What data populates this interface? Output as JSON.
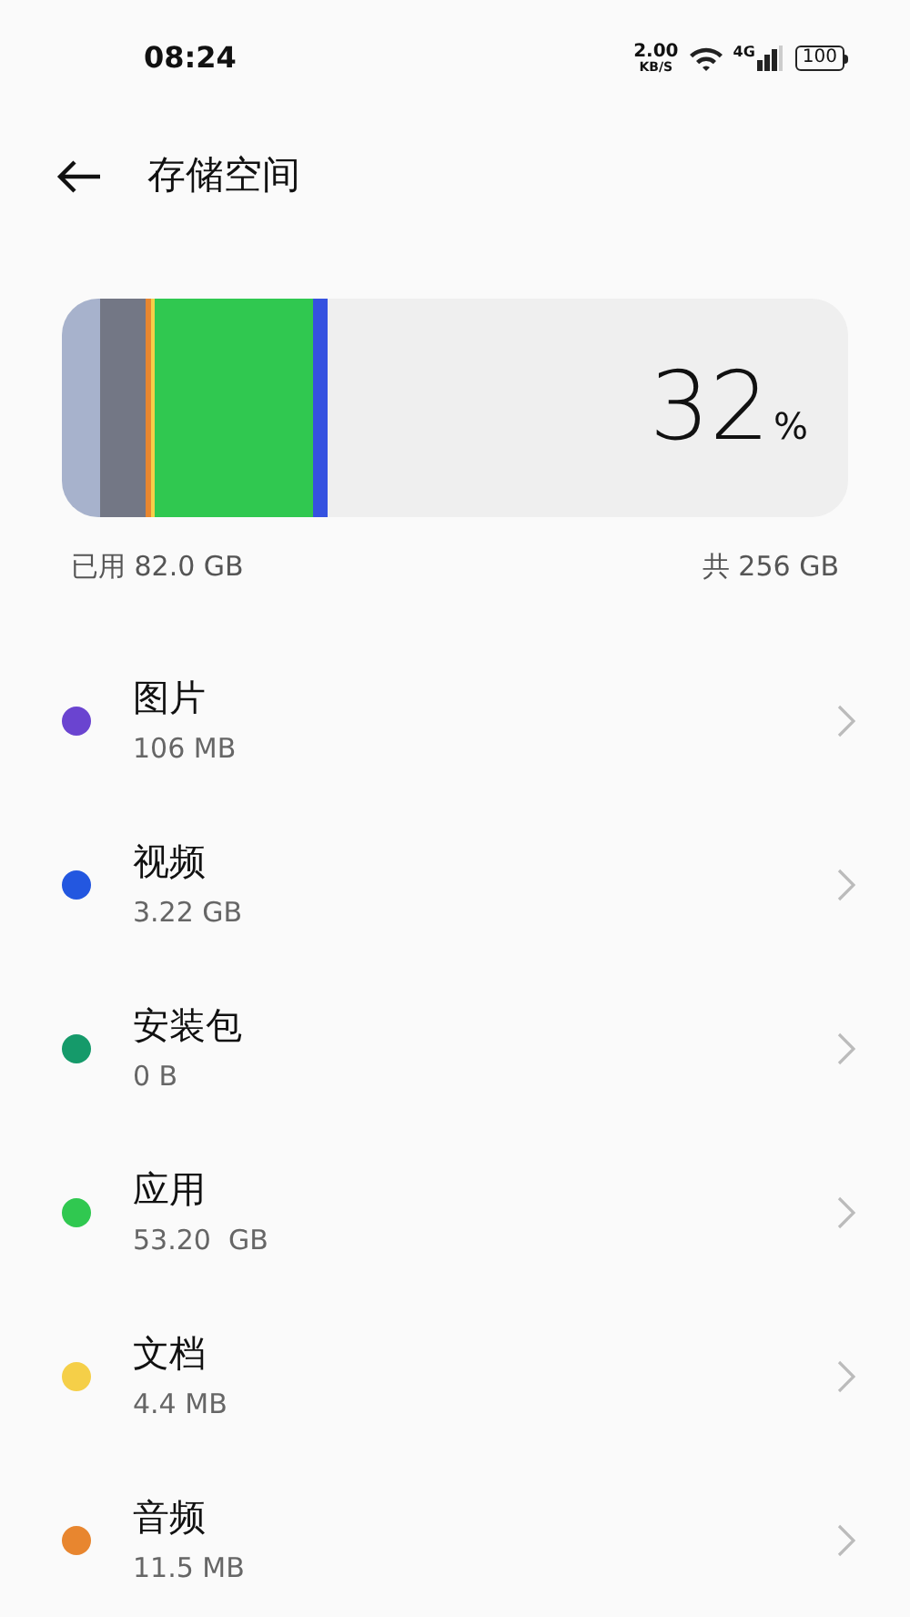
{
  "status_bar": {
    "time": "08:24",
    "speed": "2.00",
    "speed_unit": "KB/S",
    "network": "4G",
    "battery": "100"
  },
  "header": {
    "title": "存储空间"
  },
  "usage": {
    "segments": [
      {
        "color": "#a7b2cc"
      },
      {
        "color": "#737785"
      },
      {
        "color": "#e8862f"
      },
      {
        "color": "#f5cf48"
      },
      {
        "color": "#30c850"
      },
      {
        "color": "#3552e0"
      }
    ],
    "percent": "32",
    "percent_sign": "%",
    "used": "已用 82.0 GB",
    "total": "共 256 GB"
  },
  "categories": [
    {
      "name": "图片",
      "size": "106 MB",
      "color": "#6a44d0"
    },
    {
      "name": "视频",
      "size": "3.22 GB",
      "color": "#2357e0"
    },
    {
      "name": "安装包",
      "size": "0 B",
      "color": "#159a6a"
    },
    {
      "name": "应用",
      "size": "53.20  GB",
      "color": "#30c850"
    },
    {
      "name": "文档",
      "size": "4.4 MB",
      "color": "#f5cf48"
    },
    {
      "name": "音频",
      "size": "11.5 MB",
      "color": "#e8862f"
    }
  ]
}
